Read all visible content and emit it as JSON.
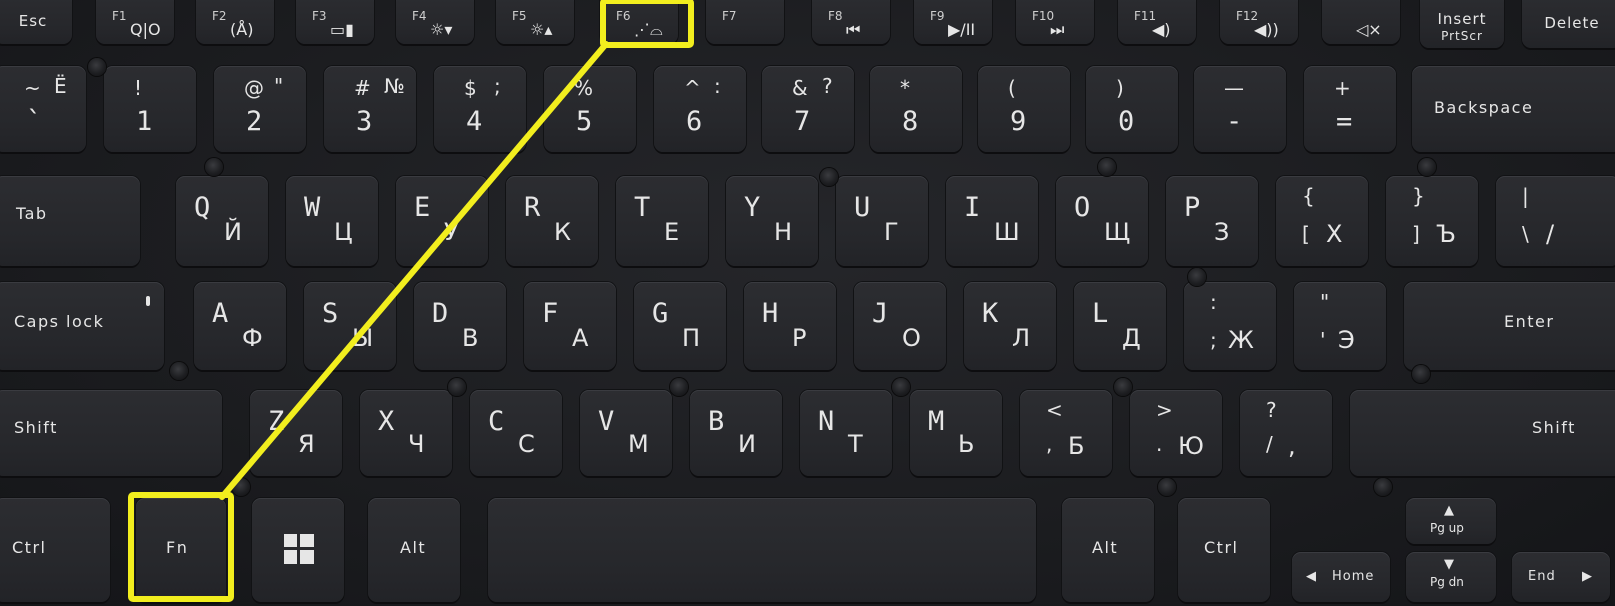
{
  "function_row": [
    {
      "id": "esc",
      "label": "Esc"
    },
    {
      "id": "f1",
      "label": "F1",
      "icon": "Q|O",
      "icon_name": "lock-io-icon"
    },
    {
      "id": "f2",
      "label": "F2",
      "icon": "(Å)",
      "icon_name": "wireless-icon"
    },
    {
      "id": "f3",
      "label": "F3",
      "icon": "▭▮",
      "icon_name": "battery-icon"
    },
    {
      "id": "f4",
      "label": "F4",
      "icon": "☼▾",
      "icon_name": "brightness-down-icon"
    },
    {
      "id": "f5",
      "label": "F5",
      "icon": "☼▴",
      "icon_name": "brightness-up-icon"
    },
    {
      "id": "f6",
      "label": "F6",
      "icon": "⋰⌓",
      "icon_name": "keyboard-backlight-icon"
    },
    {
      "id": "f7",
      "label": "F7",
      "icon": "",
      "icon_name": ""
    },
    {
      "id": "f8",
      "label": "F8",
      "icon": "⏮",
      "icon_name": "previous-track-icon"
    },
    {
      "id": "f9",
      "label": "F9",
      "icon": "▶/II",
      "icon_name": "play-pause-icon"
    },
    {
      "id": "f10",
      "label": "F10",
      "icon": "⏭",
      "icon_name": "next-track-icon"
    },
    {
      "id": "f11",
      "label": "F11",
      "icon": "◀)",
      "icon_name": "volume-down-icon"
    },
    {
      "id": "f12",
      "label": "F12",
      "icon": "◀))",
      "icon_name": "volume-up-icon"
    },
    {
      "id": "mute",
      "label": "",
      "icon": "◁×",
      "icon_name": "mute-icon"
    },
    {
      "id": "insert",
      "label": "Insert",
      "sub": "PrtScr"
    },
    {
      "id": "delete",
      "label": "Delete"
    }
  ],
  "number_row": [
    {
      "top": "~",
      "bottom": "`",
      "cyr": "Ё"
    },
    {
      "top": "!",
      "bottom": "1",
      "cyr": ""
    },
    {
      "top": "@",
      "bottom": "2",
      "cyr": "\""
    },
    {
      "top": "#",
      "bottom": "3",
      "cyr": "№"
    },
    {
      "top": "$",
      "bottom": "4",
      "cyr": ";"
    },
    {
      "top": "%",
      "bottom": "5",
      "cyr": ""
    },
    {
      "top": "^",
      "bottom": "6",
      "cyr": ":"
    },
    {
      "top": "&",
      "bottom": "7",
      "cyr": "?"
    },
    {
      "top": "*",
      "bottom": "8",
      "cyr": ""
    },
    {
      "top": "(",
      "bottom": "9",
      "cyr": ""
    },
    {
      "top": ")",
      "bottom": "0",
      "cyr": ""
    },
    {
      "top": "—",
      "bottom": "-",
      "cyr": ""
    },
    {
      "top": "+",
      "bottom": "=",
      "cyr": ""
    },
    {
      "label": "Backspace"
    }
  ],
  "qwerty_row": [
    {
      "label": "Tab"
    },
    {
      "lat": "Q",
      "cyr": "Й"
    },
    {
      "lat": "W",
      "cyr": "Ц"
    },
    {
      "lat": "E",
      "cyr": "У"
    },
    {
      "lat": "R",
      "cyr": "К"
    },
    {
      "lat": "T",
      "cyr": "Е"
    },
    {
      "lat": "Y",
      "cyr": "Н"
    },
    {
      "lat": "U",
      "cyr": "Г"
    },
    {
      "lat": "I",
      "cyr": "Ш"
    },
    {
      "lat": "O",
      "cyr": "Щ"
    },
    {
      "lat": "P",
      "cyr": "З"
    },
    {
      "top": "{",
      "bottom": "[",
      "cyr": "Х"
    },
    {
      "top": "}",
      "bottom": "]",
      "cyr": "Ъ"
    },
    {
      "top": "|",
      "bottom": "\\",
      "cyr": "/"
    }
  ],
  "home_row": [
    {
      "label": "Caps lock"
    },
    {
      "lat": "A",
      "cyr": "Ф"
    },
    {
      "lat": "S",
      "cyr": "Ы"
    },
    {
      "lat": "D",
      "cyr": "В"
    },
    {
      "lat": "F",
      "cyr": "А"
    },
    {
      "lat": "G",
      "cyr": "П"
    },
    {
      "lat": "H",
      "cyr": "Р"
    },
    {
      "lat": "J",
      "cyr": "О"
    },
    {
      "lat": "K",
      "cyr": "Л"
    },
    {
      "lat": "L",
      "cyr": "Д"
    },
    {
      "top": ":",
      "bottom": ";",
      "cyr": "Ж"
    },
    {
      "top": "\"",
      "bottom": "'",
      "cyr": "Э"
    },
    {
      "label": "Enter"
    }
  ],
  "shift_row": [
    {
      "label": "Shift"
    },
    {
      "lat": "Z",
      "cyr": "Я"
    },
    {
      "lat": "X",
      "cyr": "Ч"
    },
    {
      "lat": "C",
      "cyr": "С"
    },
    {
      "lat": "V",
      "cyr": "М"
    },
    {
      "lat": "B",
      "cyr": "И"
    },
    {
      "lat": "N",
      "cyr": "Т"
    },
    {
      "lat": "M",
      "cyr": "Ь"
    },
    {
      "top": "<",
      "bottom": ",",
      "cyr": "Б"
    },
    {
      "top": ">",
      "bottom": ".",
      "cyr": "Ю"
    },
    {
      "top": "?",
      "bottom": "/",
      "cyr": ","
    },
    {
      "label": "Shift"
    }
  ],
  "bottom_row": {
    "ctrl_left": "Ctrl",
    "fn": "Fn",
    "win_icon": "windows-logo-icon",
    "alt_left": "Alt",
    "alt_right": "Alt",
    "ctrl_right": "Ctrl",
    "pgup": "Pg up",
    "pgdn": "Pg dn",
    "home": "Home",
    "end": "End"
  },
  "highlight_color": "#f2ee1e"
}
